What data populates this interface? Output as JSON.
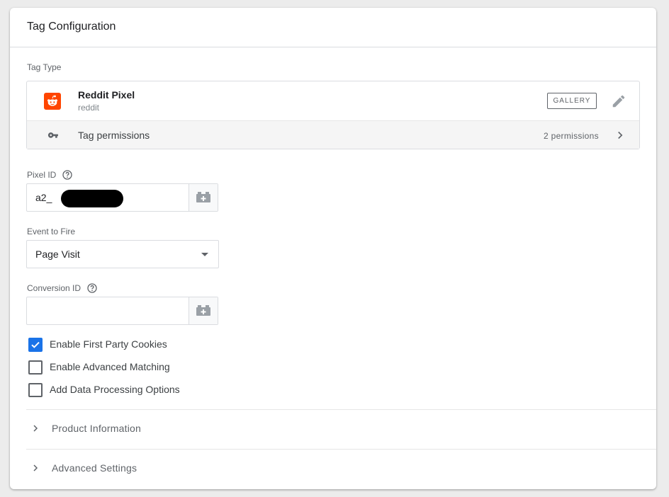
{
  "card": {
    "title": "Tag Configuration",
    "tag_type_label": "Tag Type"
  },
  "tag": {
    "name": "Reddit Pixel",
    "vendor": "reddit",
    "badge": "GALLERY",
    "logo_color": "#ff4500",
    "icons": {
      "logo": "reddit-logo-icon",
      "edit": "pencil-icon"
    }
  },
  "permissions": {
    "label": "Tag permissions",
    "count": "2 permissions",
    "icons": {
      "key": "key-icon",
      "open": "chevron-right-icon"
    }
  },
  "fields": {
    "pixel_id": {
      "label": "Pixel ID",
      "value": "a2_",
      "redacted": true
    },
    "event": {
      "label": "Event to Fire",
      "value": "Page Visit"
    },
    "conversion_id": {
      "label": "Conversion ID",
      "value": ""
    }
  },
  "checkboxes": [
    {
      "label": "Enable First Party Cookies",
      "checked": true
    },
    {
      "label": "Enable Advanced Matching",
      "checked": false
    },
    {
      "label": "Add Data Processing Options",
      "checked": false
    }
  ],
  "sections": [
    {
      "label": "Product Information"
    },
    {
      "label": "Advanced Settings"
    }
  ],
  "colors": {
    "accent": "#1a73e8",
    "border": "#dadce0",
    "text_secondary": "#5f6368"
  }
}
